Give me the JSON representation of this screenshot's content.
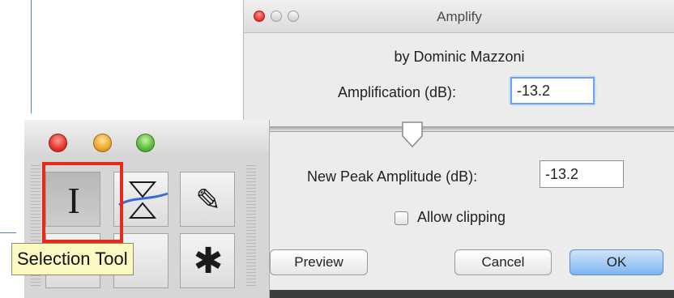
{
  "amplify_dialog": {
    "title": "Amplify",
    "author": "by Dominic Mazzoni",
    "amplification_label": "Amplification (dB):",
    "amplification_value": "-13.2",
    "slider_value_db": -13.2,
    "new_peak_label": "New Peak Amplitude (dB):",
    "new_peak_value": "-13.2",
    "allow_clipping_label": "Allow clipping",
    "allow_clipping_checked": false,
    "buttons": {
      "preview": "Preview",
      "cancel": "Cancel",
      "ok": "OK"
    }
  },
  "tools_palette": {
    "tools": [
      {
        "icon": "selection-tool-icon",
        "glyph": "I",
        "selected": true
      },
      {
        "icon": "envelope-tool-icon",
        "glyph": "",
        "selected": false
      },
      {
        "icon": "pencil-tool-icon",
        "glyph": "✎",
        "selected": false
      },
      {
        "icon": "multi-tool-icon",
        "glyph": "✱",
        "selected": false
      }
    ],
    "tooltip": "Selection Tool"
  },
  "colors": {
    "highlight_outline": "#e8291c",
    "ok_button": "#7fb4ef",
    "focus_ring": "#6aa4ec",
    "tooltip_bg": "#fbf8c2"
  }
}
